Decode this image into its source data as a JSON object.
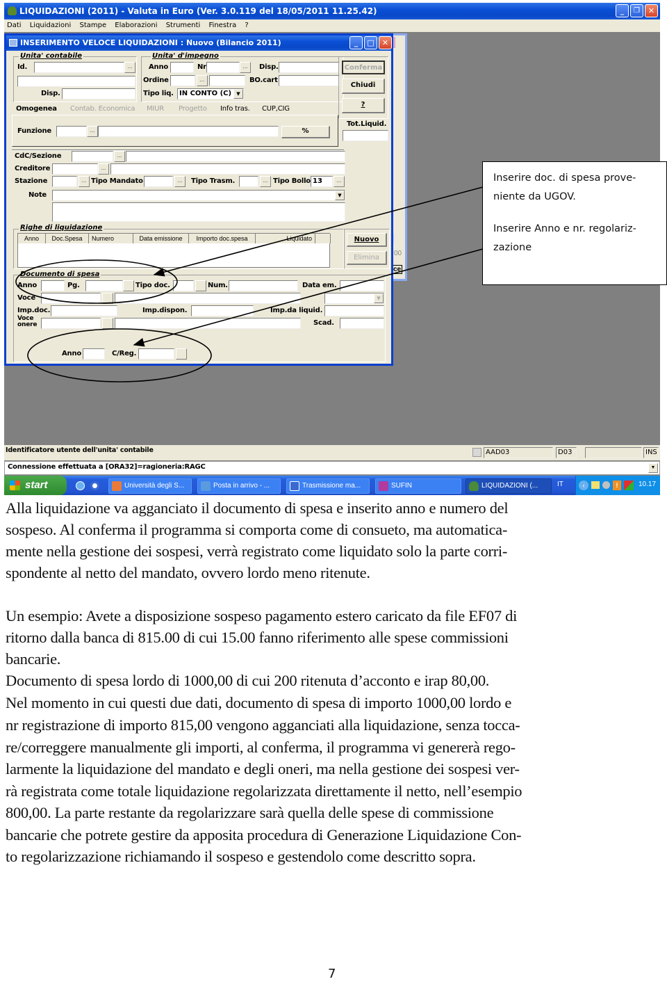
{
  "app": {
    "title": "LIQUIDAZIONI (2011)  - Valuta in Euro  (Ver. 3.0.119 del 18/05/2011 11.25.42)",
    "menu": [
      "Dati",
      "Liquidazioni",
      "Stampe",
      "Elaborazioni",
      "Strumenti",
      "Finestra",
      "?"
    ],
    "window_controls": {
      "minimize": "_",
      "restore": "❐",
      "close": "✕"
    }
  },
  "dialog": {
    "title": "INSERIMENTO VELOCE LIQUIDAZIONI : Nuovo (Bilancio 2011)",
    "unita_contabile": {
      "group": "Unita' contabile",
      "id_label": "Id.",
      "disp_label": "Disp."
    },
    "unita_impegno": {
      "group": "Unita' d'impegno",
      "anno_label": "Anno",
      "nr_label": "Nr",
      "disp_label": "Disp.",
      "ordine_label": "Ordine",
      "bocart_label": "BO.cart",
      "tipo_liq_label": "Tipo liq.",
      "tipo_liq_value": "IN CONTO (C)"
    },
    "buttons": {
      "conferma": "Conferma",
      "chiudi": "Chiudi",
      "help": "?",
      "nuovo": "Nuovo",
      "elimina": "Elimina",
      "percent": "%",
      "dots": "..."
    },
    "tot_liquid_label": "Tot.Liquid.",
    "tabs": [
      {
        "label": "Omogenea",
        "active": true
      },
      {
        "label": "Contab. Economica",
        "active": false
      },
      {
        "label": "MIUR",
        "active": false
      },
      {
        "label": "Progetto",
        "active": false
      },
      {
        "label": "Info tras.",
        "active": true
      },
      {
        "label": "CUP,CIG",
        "active": true
      }
    ],
    "funzione_label": "Funzione",
    "cdc_label": "CdC/Sezione",
    "creditore_label": "Creditore",
    "stazione_label": "Stazione",
    "tipo_mandato_label": "Tipo Mandato",
    "tipo_trasm_label": "Tipo Trasm.",
    "tipo_bollo_label": "Tipo Bollo",
    "tipo_bollo_value": "13",
    "note_label": "Note",
    "righe": {
      "group": "Righe di liquidazione",
      "columns": [
        "Anno",
        "Doc.Spesa",
        "Numero",
        "Data emissione",
        "Importo doc.spesa",
        "Liquidato"
      ]
    },
    "documento": {
      "group": "Documento di spesa",
      "anno_label": "Anno",
      "pg_label": "Pg.",
      "tipo_doc_label": "Tipo doc.",
      "num_label": "Num.",
      "data_em_label": "Data em.",
      "voce_label": "Voce",
      "imp_doc_label": "Imp.doc.",
      "imp_dispon_label": "Imp.dispon.",
      "imp_da_liquid_label": "Imp.da liquid.",
      "voce_onere_label": "Voce onere",
      "scad_label": "Scad."
    },
    "regolarizzazione": {
      "anno_label": "Anno",
      "creg_label": "C/Reg."
    }
  },
  "background_window_fragments": {
    "value_00": "00",
    "btn_ce": "ce"
  },
  "status": {
    "identificatore": "Identificatore utente dell'unita' contabile",
    "user": "AAD03",
    "code": "D03",
    "empty": "",
    "mode": "INS",
    "connessione": "Connessione effettuata a [ORA32]=ragioneria:RAGC"
  },
  "taskbar": {
    "start": "start",
    "items": [
      {
        "label": "Università degli S...",
        "icon": "browser-icon",
        "color": "#e87a3c"
      },
      {
        "label": "Posta in arrivo - ...",
        "icon": "mail-icon",
        "color": "#5a9adf"
      },
      {
        "label": "Trasmissione ma...",
        "icon": "word-icon",
        "color": "#3a6ad0"
      },
      {
        "label": "SUFIN",
        "icon": "app-icon",
        "color": "#b03aa0"
      },
      {
        "label": "LIQUIDAZIONI (...",
        "icon": "liquidazioni-icon",
        "color": "#4a8a3a",
        "active": true
      }
    ],
    "lang": "IT",
    "clock": "10.17"
  },
  "callout": {
    "line1": "Inserire doc. di spesa prove-niente da UGOV.",
    "line2": "Inserire Anno e nr. regolariz-zazione"
  },
  "document": {
    "paragraphs": [
      "Alla liquidazione va agganciato il documento di spesa e inserito anno e numero del sospeso. Al conferma il programma si comporta come di consueto, ma automatica-mente nella gestione dei  sospesi, verrà registrato come liquidato solo la parte corri-spondente al netto del mandato, ovvero lordo meno ritenute.",
      "Un esempio: Avete a disposizione sospeso pagamento estero caricato da file EF07 di ritorno dalla banca di 815.00 di cui 15.00 fanno riferimento alle spese commissioni bancarie.",
      "Documento di spesa lordo di 1000,00 di cui 200 ritenuta d’acconto e irap 80,00.",
      "Nel momento in cui questi due dati, documento di spesa di importo 1000,00 lordo e nr registrazione di importo 815,00 vengono agganciati alla liquidazione, senza tocca-re/correggere manualmente gli importi, al conferma, il programma vi genererà rego-larmente la liquidazione del mandato e degli oneri, ma nella gestione dei sospesi ver-rà registrata come totale liquidazione regolarizzata direttamente il netto, nell’esempio 800,00. La parte restante da regolarizzare sarà quella delle spese di commissione bancarie che potrete gestire da apposita procedura di Generazione Liquidazione Con-to regolarizzazione richiamando il sospeso e gestendolo come descritto sopra."
    ],
    "lines": [
      "Alla liquidazione va agganciato il documento di spesa e inserito anno e numero del",
      "sospeso. Al conferma il programma si comporta come di consueto, ma automatica-",
      "mente nella gestione dei  sospesi, verrà registrato come liquidato solo la parte corri-",
      "spondente al netto del mandato, ovvero lordo meno ritenute.",
      "Un esempio: Avete a disposizione sospeso pagamento estero caricato da file EF07 di",
      "ritorno dalla banca di 815.00 di cui 15.00 fanno riferimento alle spese commissioni",
      "bancarie.",
      "Documento di spesa lordo di 1000,00 di cui 200 ritenuta d’acconto e irap 80,00.",
      "Nel momento in cui questi due dati, documento di spesa di importo 1000,00 lordo e",
      "nr registrazione di importo 815,00 vengono agganciati alla liquidazione, senza tocca-",
      "re/correggere manualmente gli importi, al conferma, il programma vi genererà rego-",
      "larmente la liquidazione del mandato e degli oneri, ma nella gestione dei sospesi ver-",
      "rà registrata come totale liquidazione regolarizzata direttamente il netto, nell’esempio",
      "800,00. La parte restante da regolarizzare sarà quella delle spese di commissione",
      "bancarie che potrete gestire da apposita procedura di Generazione Liquidazione Con-",
      "to regolarizzazione richiamando il sospeso e gestendolo come descritto sopra."
    ],
    "page_number": "7"
  }
}
